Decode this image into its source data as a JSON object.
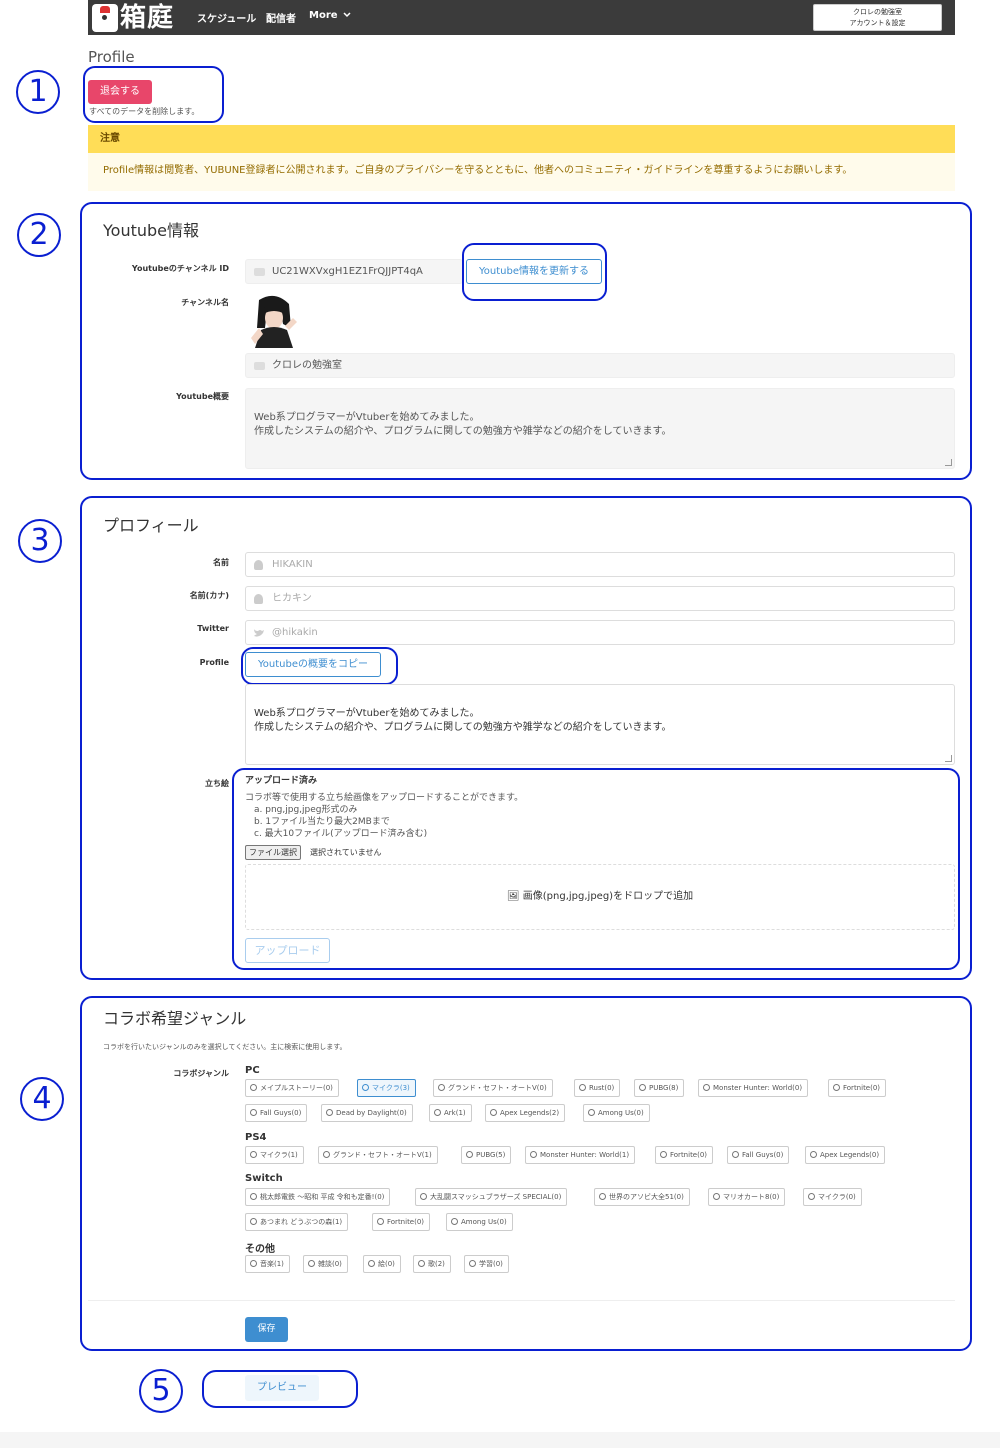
{
  "nav": {
    "logo_text": "箱庭",
    "links": [
      "スケジュール",
      "配信者",
      "More"
    ],
    "account": {
      "line1": "クロレの勉強室",
      "line2": "アカウント＆設定"
    }
  },
  "page": {
    "title": "Profile"
  },
  "withdraw": {
    "button": "退会する",
    "note": "すべてのデータを削除します。"
  },
  "notice": {
    "title": "注意",
    "body": "Profile情報は閲覧者、YUBUNE登録者に公開されます。ご自身のプライバシーを守るとともに、他者へのコミュニティ・ガイドラインを尊重するようにお願いします。"
  },
  "annotations": [
    "1",
    "2",
    "3",
    "4",
    "5"
  ],
  "youtube": {
    "title": "Youtube情報",
    "channel_id_label": "Youtubeのチャンネル ID",
    "channel_id": "UC21WXVxgH1EZ1FrQJJPT4qA",
    "refresh_button": "Youtube情報を更新する",
    "channel_name_label": "チャンネル名",
    "channel_name": "クロレの勉強室",
    "summary_label": "Youtube概要",
    "summary": "Web系プログラマーがVtuberを始めてみました。\n作成したシステムの紹介や、プログラムに関しての勉強方や雑学などの紹介をしていきます。"
  },
  "profile": {
    "title": "プロフィール",
    "name_label": "名前",
    "name_placeholder": "HIKAKIN",
    "kana_label": "名前(カナ)",
    "kana_placeholder": "ヒカキン",
    "twitter_label": "Twitter",
    "twitter_placeholder": "@hikakin",
    "profile_label": "Profile",
    "copy_button": "Youtubeの概要をコピー",
    "profile_text": "Web系プログラマーがVtuberを始めてみました。\n作成したシステムの紹介や、プログラムに関しての勉強方や雑学などの紹介をしていきます。",
    "tachie_label": "立ち絵",
    "upload_title": "アップロード済み",
    "upload_help": "コラボ等で使用する立ち絵画像をアップロードすることができます。\n　a. png,jpg,jpeg形式のみ\n　b. 1ファイル当たり最大2MBまで\n　c. 最大10ファイル(アップロード済み含む)",
    "file_button": "ファイル選択",
    "file_status": "選択されていません",
    "dropzone": "🖼 画像(png,jpg,jpeg)をドロップで追加",
    "upload_button": "アップロード"
  },
  "collab": {
    "title": "コラボ希望ジャンル",
    "note": "コラボを行いたいジャンルのみを選択してください。主に検索に使用します。",
    "genre_label": "コラボジャンル",
    "groups": [
      {
        "name": "PC",
        "tags": [
          "メイプルストーリー(0)",
          "マイクラ(3)",
          "グランド・セフト・オートV(0)",
          "Rust(0)",
          "PUBG(8)",
          "Monster Hunter: World(0)",
          "Fortnite(0)",
          "Fall Guys(0)",
          "Dead by Daylight(0)",
          "Ark(1)",
          "Apex Legends(2)",
          "Among Us(0)"
        ]
      },
      {
        "name": "PS4",
        "tags": [
          "マイクラ(1)",
          "グランド・セフト・オートV(1)",
          "PUBG(5)",
          "Monster Hunter: World(1)",
          "Fortnite(0)",
          "Fall Guys(0)",
          "Apex Legends(0)"
        ]
      },
      {
        "name": "Switch",
        "tags": [
          "桃太郎電鉄 〜昭和 平成 令和も定番!(0)",
          "大乱闘スマッシュブラザーズ SPECIAL(0)",
          "世界のアソビ大全51(0)",
          "マリオカート8(0)",
          "マイクラ(0)",
          "あつまれ どうぶつの森(1)",
          "Fortnite(0)",
          "Among Us(0)"
        ]
      },
      {
        "name": "その他",
        "tags": [
          "音楽(1)",
          "雑談(0)",
          "絵(0)",
          "歌(2)",
          "学習(0)"
        ]
      }
    ],
    "save_button": "保存"
  },
  "preview_button": "プレビュー",
  "colors": {
    "accent": "#3e8ed0",
    "danger": "#e8466a",
    "warning": "#ffdd57",
    "annotation": "#0a1fd1"
  }
}
